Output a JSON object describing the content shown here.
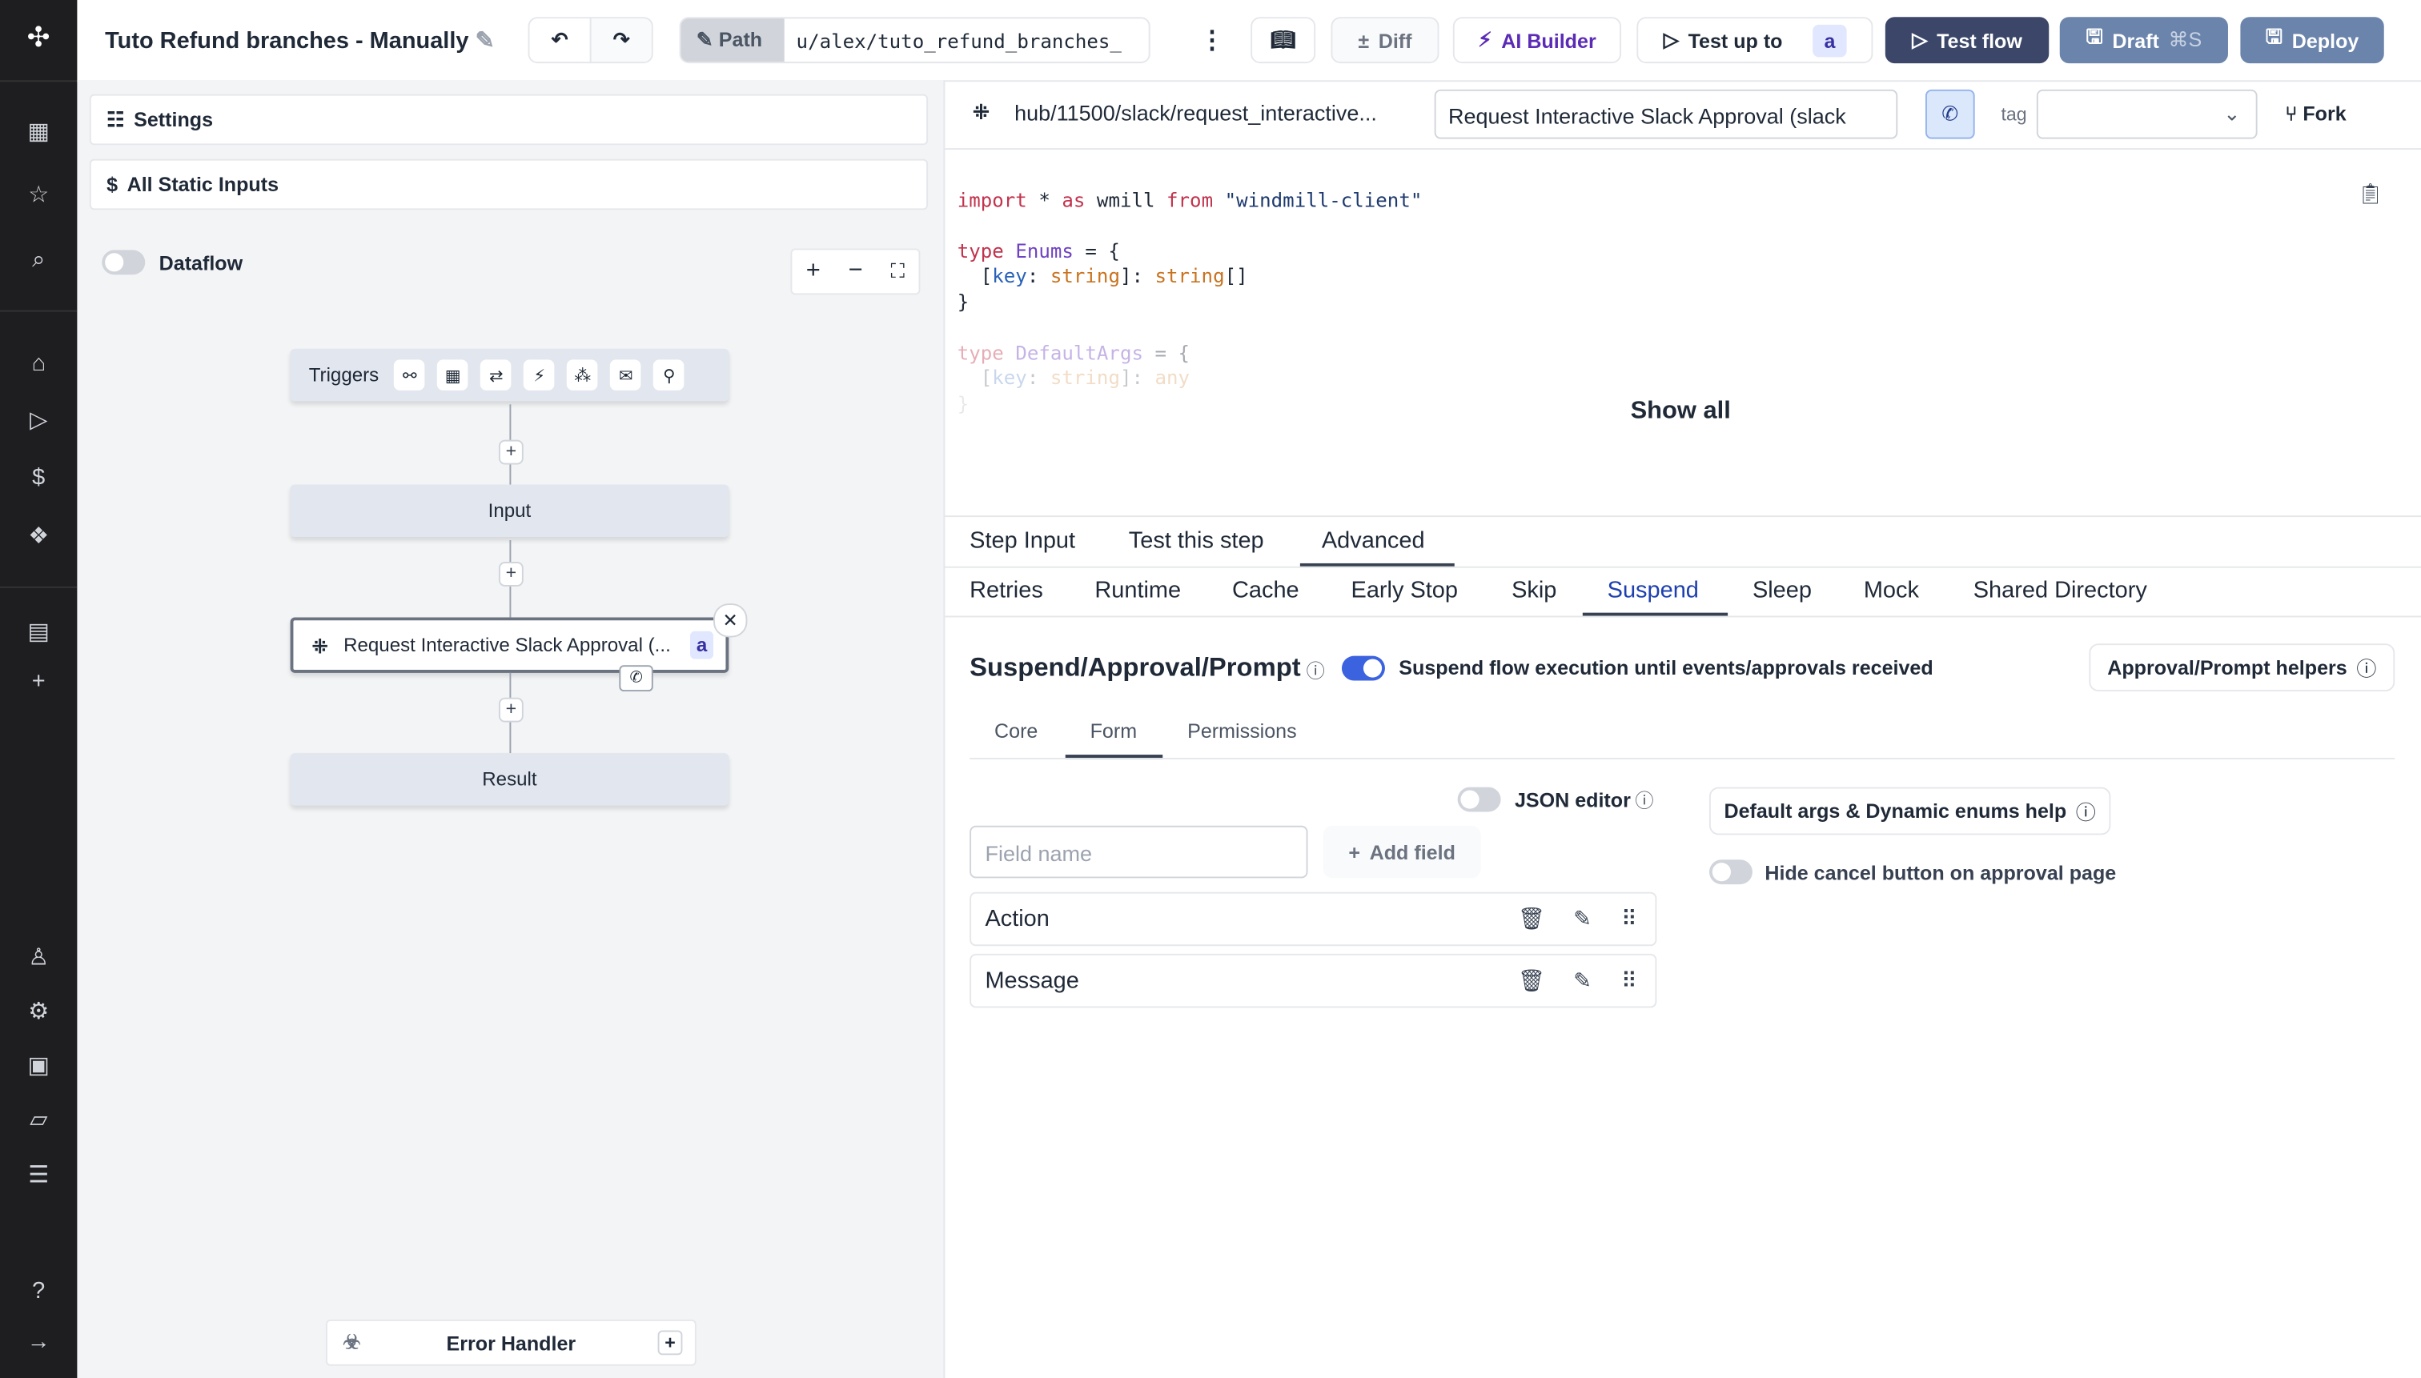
{
  "app": {
    "title": "Tuto Refund branches - Manually",
    "path_label": "Path",
    "path_value": "u/alex/tuto_refund_branches_"
  },
  "toolbar": {
    "diff": "Diff",
    "ai_builder": "AI Builder",
    "test_up_to": "Test up to",
    "test_up_to_badge": "a",
    "test_flow": "Test flow",
    "draft": "Draft",
    "draft_shortcut": "⌘S",
    "deploy": "Deploy"
  },
  "colors": {
    "accent": "#3b63e0",
    "test_flow_bg": "#3b4668",
    "draft_bg": "#6b84ab",
    "ai_builder": "#5b2bb5"
  },
  "left": {
    "settings": "Settings",
    "static_inputs": "All Static Inputs",
    "dataflow": "Dataflow",
    "dataflow_on": false,
    "nodes": {
      "triggers": "Triggers",
      "input": "Input",
      "step": "Request Interactive Slack Approval (...",
      "step_badge": "a",
      "result": "Result"
    },
    "error_handler": "Error Handler"
  },
  "step_header": {
    "path": "hub/11500/slack/request_interactive...",
    "summary": "Request Interactive Slack Approval (slack",
    "tag_label": "tag",
    "tag_value": "",
    "fork": "Fork"
  },
  "code": {
    "l1": [
      "import",
      " * ",
      "as",
      " wmill ",
      "from",
      " \"windmill-client\""
    ],
    "l3": [
      "type",
      " Enums",
      " = {"
    ],
    "l4": [
      "  [",
      "key",
      ": ",
      "string",
      "]: ",
      "string",
      "[]"
    ],
    "l5": "}",
    "l7": [
      "type",
      " DefaultArgs",
      " = {"
    ],
    "l8": [
      "  [",
      "key",
      ": ",
      "string",
      "]: ",
      "any"
    ],
    "l9": "}",
    "show_all": "Show all"
  },
  "tabs": {
    "primary": [
      "Step Input",
      "Test this step",
      "Advanced"
    ],
    "primary_active": "Advanced",
    "secondary": [
      "Retries",
      "Runtime",
      "Cache",
      "Early Stop",
      "Skip",
      "Suspend",
      "Sleep",
      "Mock",
      "Shared Directory"
    ],
    "secondary_active": "Suspend"
  },
  "suspend": {
    "title": "Suspend/Approval/Prompt",
    "toggle_label": "Suspend flow execution until events/approvals received",
    "toggle_on": true,
    "helpers": "Approval/Prompt helpers",
    "subtabs": [
      "Core",
      "Form",
      "Permissions"
    ],
    "subtab_active": "Form",
    "json_editor": "JSON editor",
    "json_editor_on": false,
    "field_placeholder": "Field name",
    "add_field": "Add field",
    "fields": [
      "Action",
      "Message"
    ],
    "default_args_help": "Default args & Dynamic enums help",
    "hide_cancel": "Hide cancel button on approval page",
    "hide_cancel_on": false
  }
}
